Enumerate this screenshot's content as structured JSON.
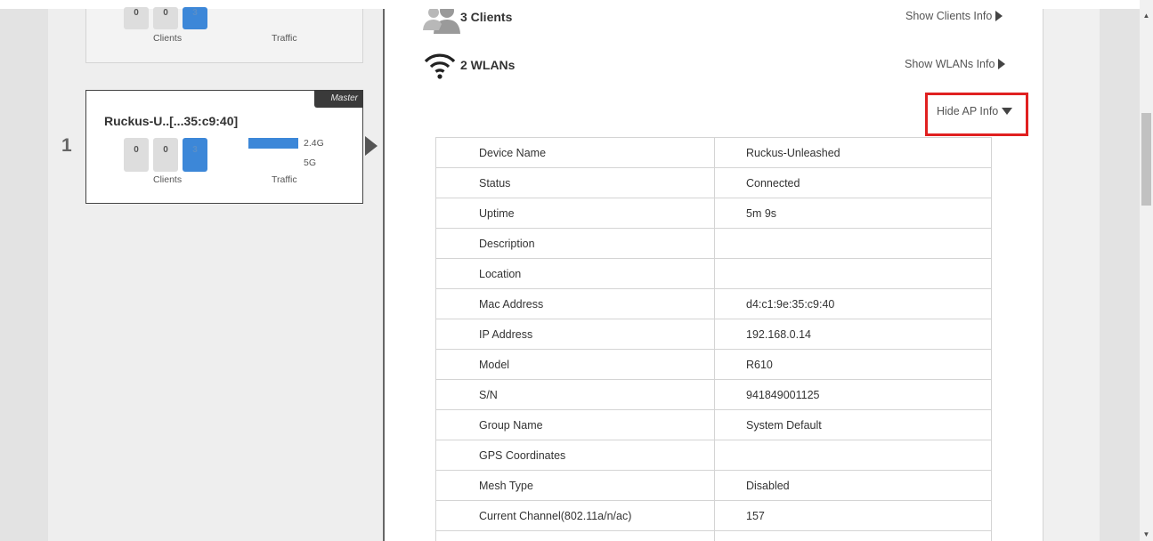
{
  "ap_cards": [
    {
      "title": "",
      "counts": [
        "0",
        "0",
        "3"
      ],
      "clients_label": "Clients",
      "traffic_label": "Traffic"
    },
    {
      "index": "1",
      "badge": "Master",
      "title": "Ruckus-U..[...35:c9:40]",
      "counts": [
        "0",
        "0",
        "3"
      ],
      "clients_label": "Clients",
      "traffic_label": "Traffic",
      "bands": [
        {
          "label": "2.4G",
          "fill": 1.0
        },
        {
          "label": "5G",
          "fill": 0.0
        }
      ]
    }
  ],
  "sections": {
    "clients": {
      "title": "3 Clients",
      "link": "Show Clients Info",
      "icon": "clients-icon"
    },
    "wlans": {
      "title": "2 WLANs",
      "link": "Show WLANs Info",
      "icon": "wifi-icon"
    },
    "ap_info": {
      "link": "Hide AP Info"
    }
  },
  "ap_info_rows": [
    {
      "key": "Device Name",
      "value": "Ruckus-Unleashed"
    },
    {
      "key": "Status",
      "value": "Connected"
    },
    {
      "key": "Uptime",
      "value": "5m 9s"
    },
    {
      "key": "Description",
      "value": ""
    },
    {
      "key": "Location",
      "value": ""
    },
    {
      "key": "Mac Address",
      "value": "d4:c1:9e:35:c9:40"
    },
    {
      "key": "IP Address",
      "value": "192.168.0.14"
    },
    {
      "key": "Model",
      "value": "R610"
    },
    {
      "key": "S/N",
      "value": "941849001125"
    },
    {
      "key": "Group Name",
      "value": "System Default"
    },
    {
      "key": "GPS Coordinates",
      "value": ""
    },
    {
      "key": "Mesh Type",
      "value": "Disabled"
    },
    {
      "key": "Current Channel(802.11a/n/ac)",
      "value": "157"
    },
    {
      "key": "",
      "value": ""
    }
  ],
  "colors": {
    "accent": "#3c87d8",
    "highlight_border": "#e02020",
    "master_badge": "#3a3a3a"
  }
}
